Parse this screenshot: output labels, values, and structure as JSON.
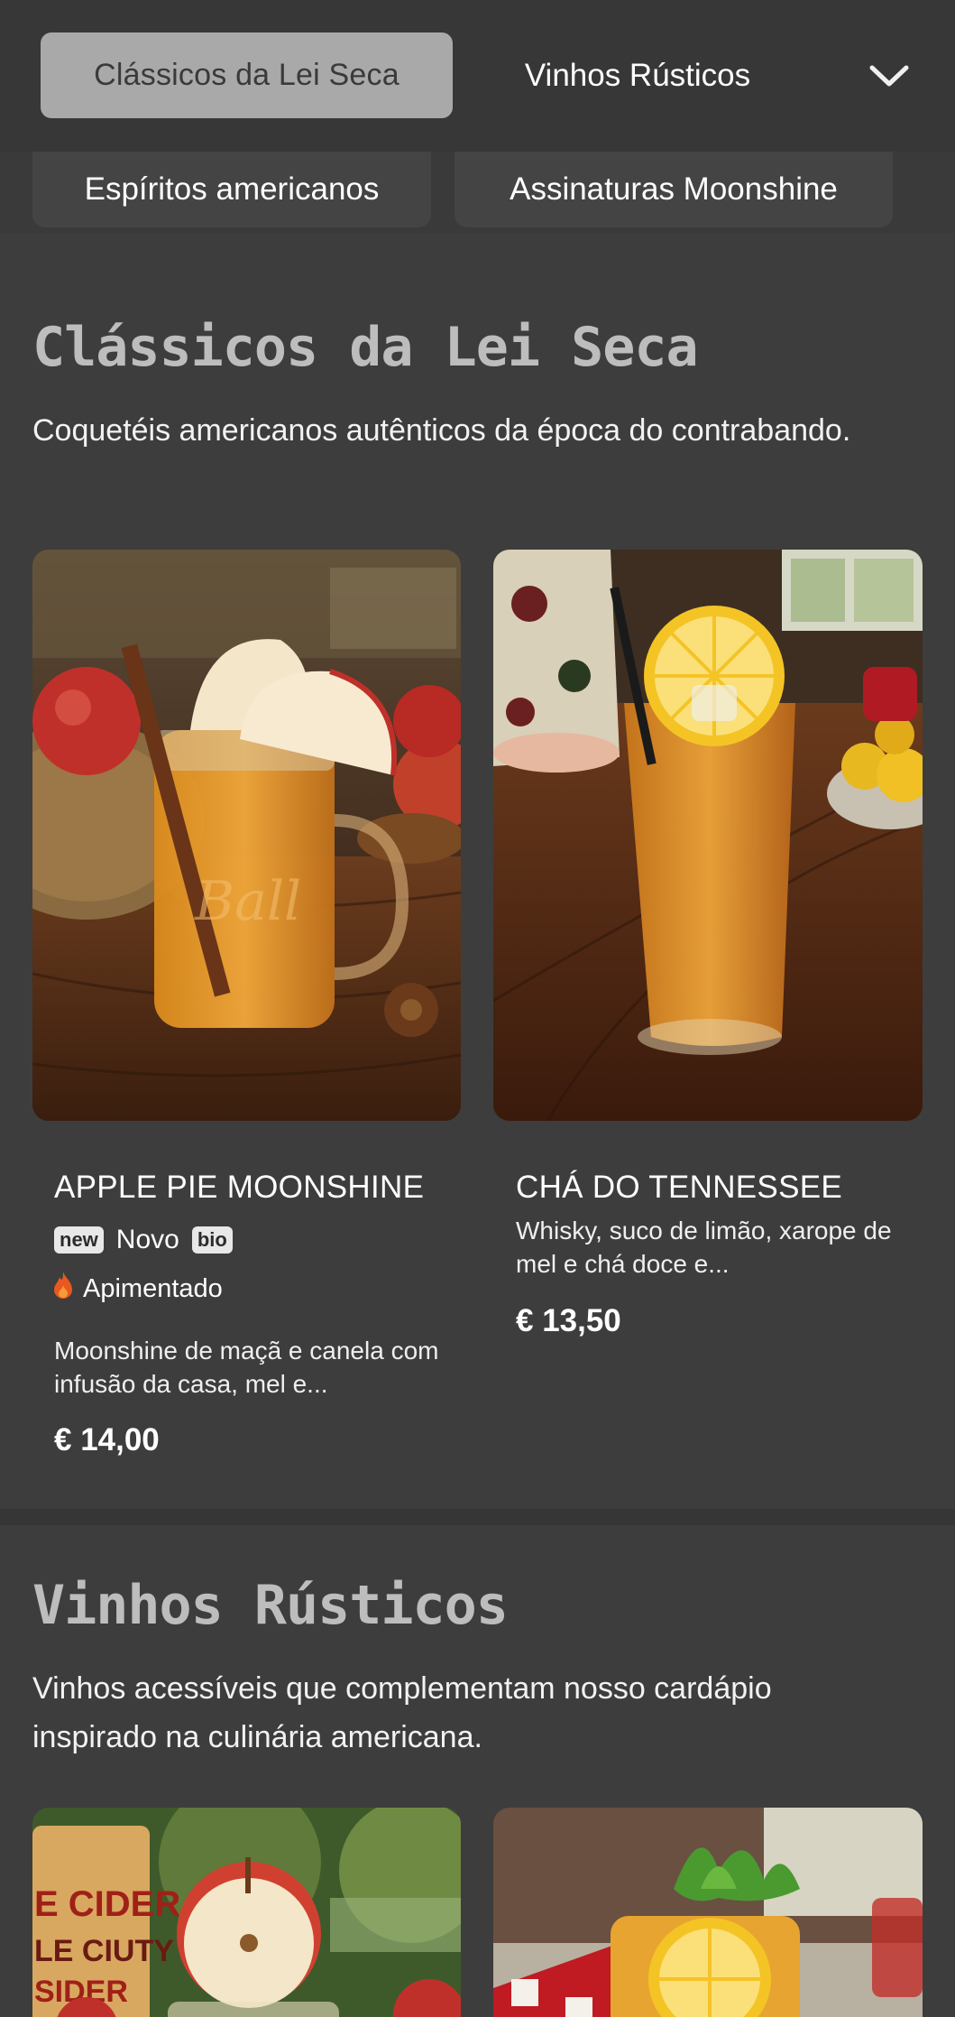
{
  "nav": {
    "tabs": [
      {
        "label": "Clássicos da Lei Seca",
        "active": true
      },
      {
        "label": "Vinhos Rústicos",
        "active": false
      }
    ],
    "more_icon": "chevron-down-icon",
    "chips": [
      {
        "label": "Espíritos americanos"
      },
      {
        "label": "Assinaturas Moonshine"
      }
    ]
  },
  "sections": [
    {
      "title": "Clássicos da Lei Seca",
      "description": "Coquetéis americanos autênticos da época do contrabando.",
      "items": [
        {
          "name": "APPLE PIE MOONSHINE",
          "badges": [
            "new",
            "bio"
          ],
          "badge_text": "Novo",
          "spicy_icon": "flame-icon",
          "spicy_label": "Apimentado",
          "description": "Moonshine de maçã e canela com infusão da casa, mel e...",
          "price": "€ 14,00"
        },
        {
          "name": "CHÁ DO TENNESSEE",
          "description": "Whisky, suco de limão, xarope de mel e chá doce e...",
          "price": "€ 13,50"
        }
      ]
    },
    {
      "title": "Vinhos Rústicos",
      "description": "Vinhos acessíveis que complementam nosso cardápio inspirado na culinária americana.",
      "image_text": [
        "E CIDER",
        "LE CIUTY",
        "SIDER"
      ]
    }
  ],
  "colors": {
    "background": "#3d3d3d",
    "active_tab": "#a9a9a9",
    "title_gray": "#bdbdbd",
    "spicy": "#e8581f"
  }
}
